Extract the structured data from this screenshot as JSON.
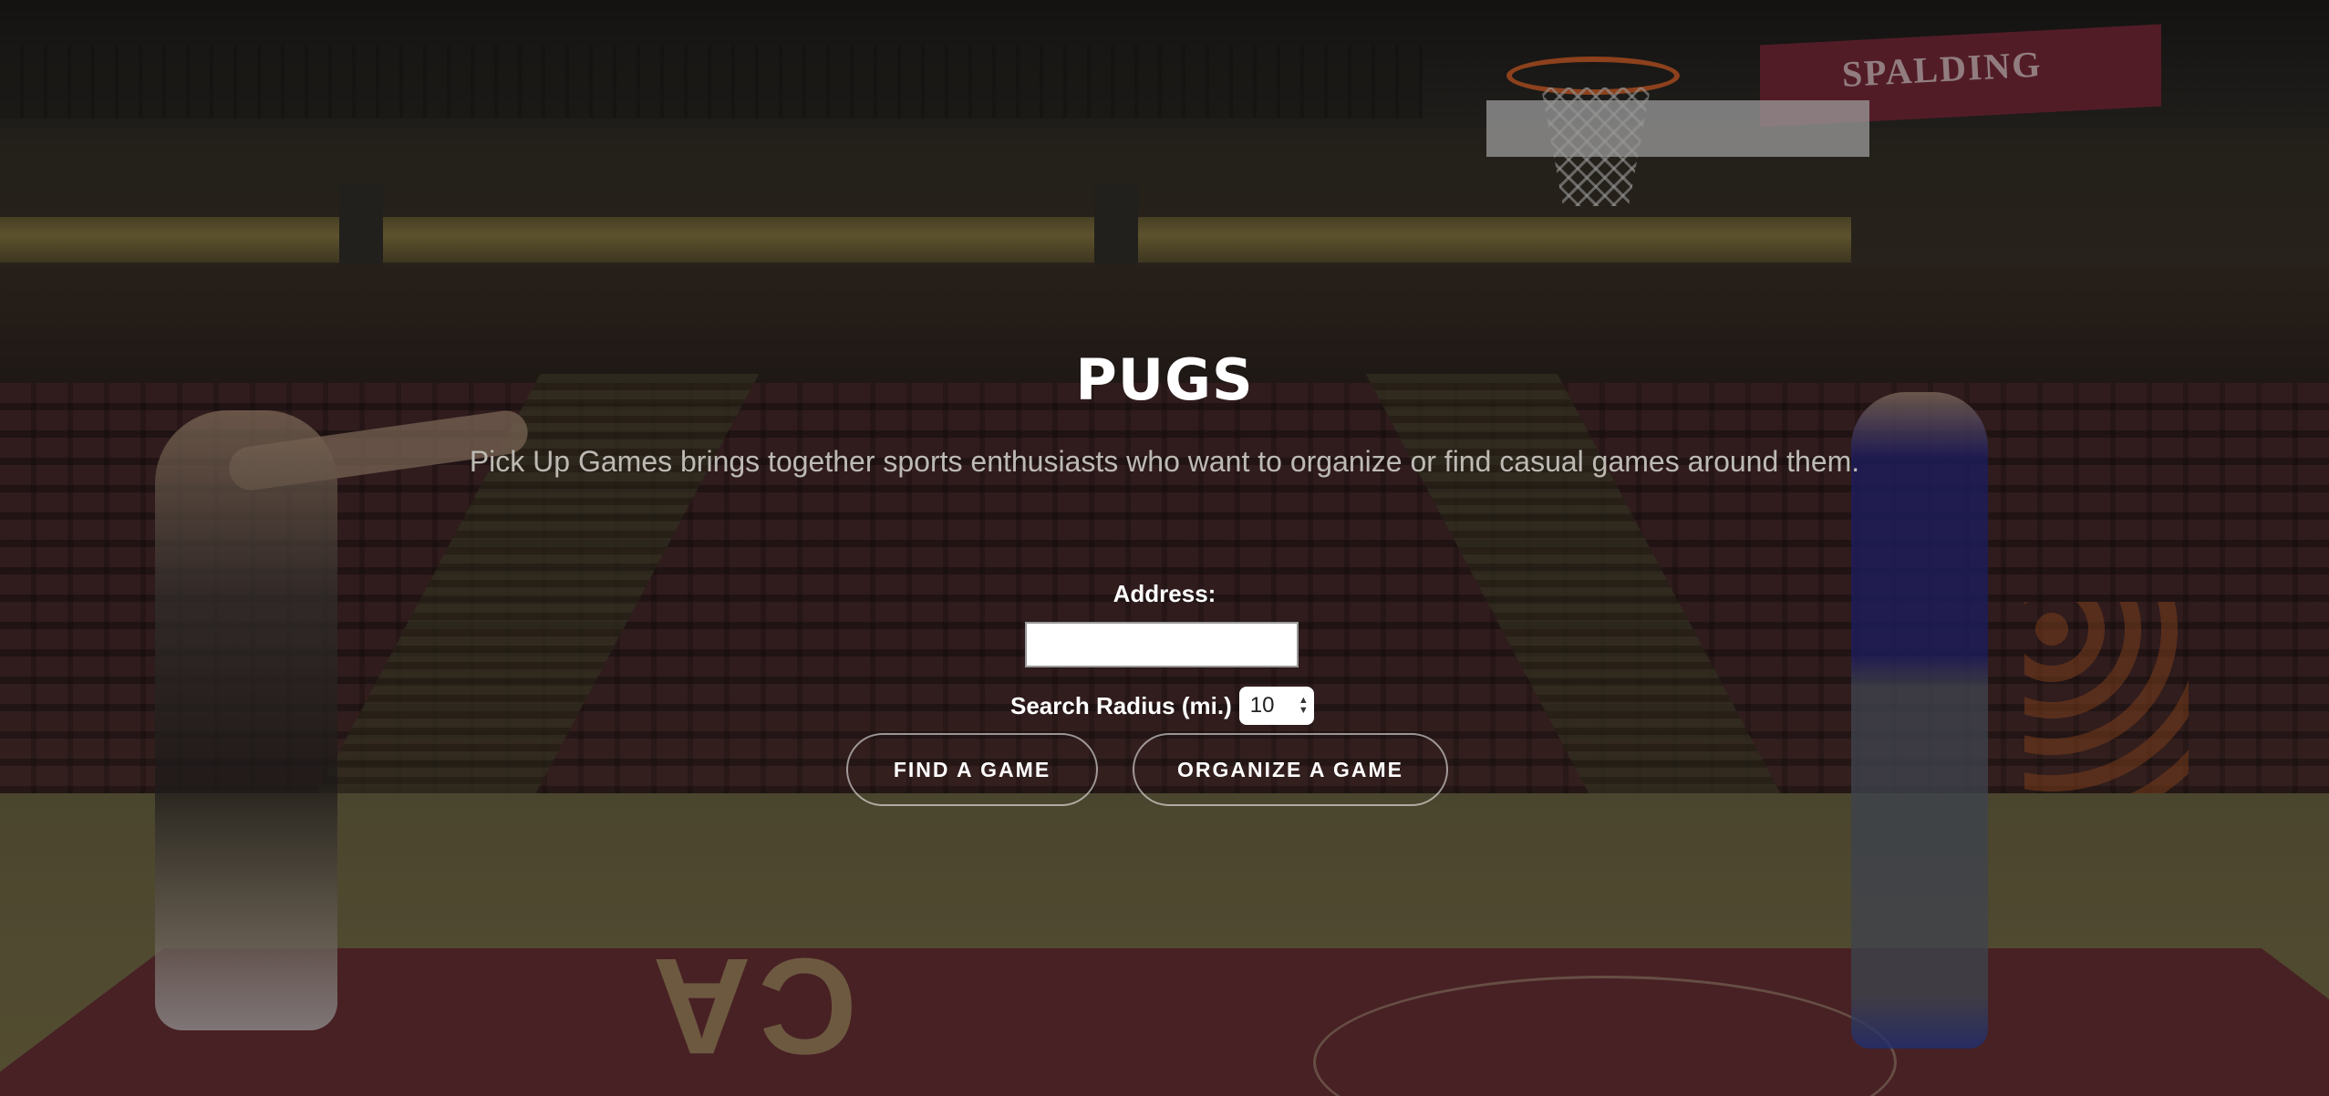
{
  "hero": {
    "title": "PUGS",
    "tagline": "Pick Up Games brings together sports enthusiasts who want to organize or find casual games around them."
  },
  "search": {
    "address_label": "Address:",
    "address_value": "",
    "address_placeholder": "",
    "radius_label": "Search Radius (mi.)",
    "radius_value": "10"
  },
  "actions": {
    "find_label": "FIND A GAME",
    "organize_label": "ORGANIZE A GAME"
  },
  "background": {
    "banner_text": "SPALDING",
    "court_text": "CA"
  },
  "colors": {
    "title": "#ffffff",
    "tagline": "#bdbab4",
    "button_border": "rgba(255,255,255,0.55)"
  }
}
